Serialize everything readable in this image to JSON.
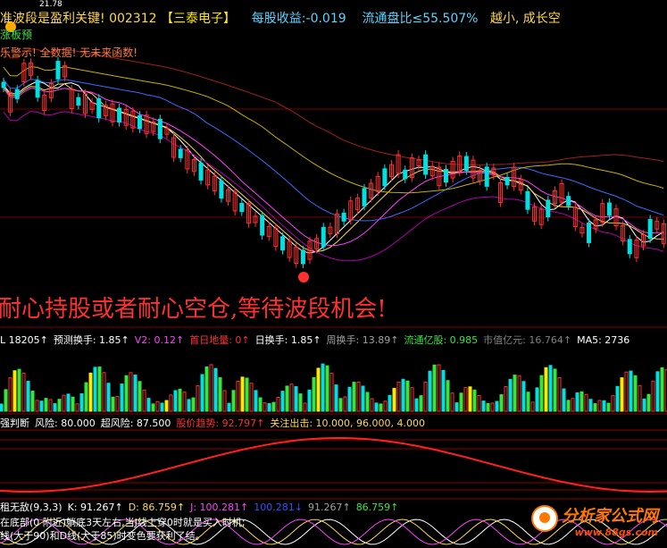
{
  "header": {
    "title_prefix": "准波段是盈利关键!",
    "stock_code": "002312",
    "stock_name": "【三泰电子】",
    "eps_label": "每股收益:-0.019",
    "float_label": "流通盘比≤55.507%",
    "tail": "越小, 成长空"
  },
  "subheaders": {
    "line1": "涨板预",
    "line2": "乐警示! 全数据! 无未来函数!"
  },
  "price_marker_top": "21.78",
  "slogan": "耐心持股或者耐心空仓,等待波段机会!",
  "volume_indicators": [
    {
      "text": "L 18205↑",
      "color": "#ffffff"
    },
    {
      "text": "预测换手: 1.85↑",
      "color": "#ffffff"
    },
    {
      "text": "V2: 0.12↑",
      "color": "#ff40ff"
    },
    {
      "text": "首日地量: 0↑",
      "color": "#ff3030"
    },
    {
      "text": "日换手: 1.85↑",
      "color": "#ffffff"
    },
    {
      "text": "周换手: 13.89↑",
      "color": "#a0a0a0"
    },
    {
      "text": "流通亿股: 0.985",
      "color": "#36e63a"
    },
    {
      "text": "市值亿元: 16.764↑",
      "color": "#808080"
    },
    {
      "text": "MA5: 2736",
      "color": "#ffffff"
    }
  ],
  "risk_indicators": [
    {
      "text": "强判断",
      "color": "#ffffff"
    },
    {
      "text": "风险: 80.000",
      "color": "#ffffff"
    },
    {
      "text": "超风险: 87.500",
      "color": "#ffffff"
    },
    {
      "text": "股价趋势: 92.797↑",
      "color": "#ff3030"
    },
    {
      "text": "关注出击: 10.000, 96.000, 4.000",
      "color": "#ffd84a"
    }
  ],
  "kdj_indicators": [
    {
      "text": "租无敌(9,3,3)",
      "color": "#ffffff"
    },
    {
      "text": "K: 91.267↑",
      "color": "#ffffff"
    },
    {
      "text": "D: 86.759↑",
      "color": "#ffd84a"
    },
    {
      "text": "J: 100.281↑",
      "color": "#ff40ff"
    },
    {
      "text": "100.281↓",
      "color": "#3050ff"
    },
    {
      "text": "91.267↑",
      "color": "#a0a0a0"
    },
    {
      "text": "86.759↑",
      "color": "#36e63a"
    }
  ],
  "notes": {
    "line1": "在底部(0 附近)躺底3天左右,当J线上穿0时就是买入时机;",
    "line2": "线(大于90)和D线(大于85)时变色要获利了结。"
  },
  "watermark": {
    "logo": "分析家公式网",
    "url": "www.88gs.com"
  }
}
